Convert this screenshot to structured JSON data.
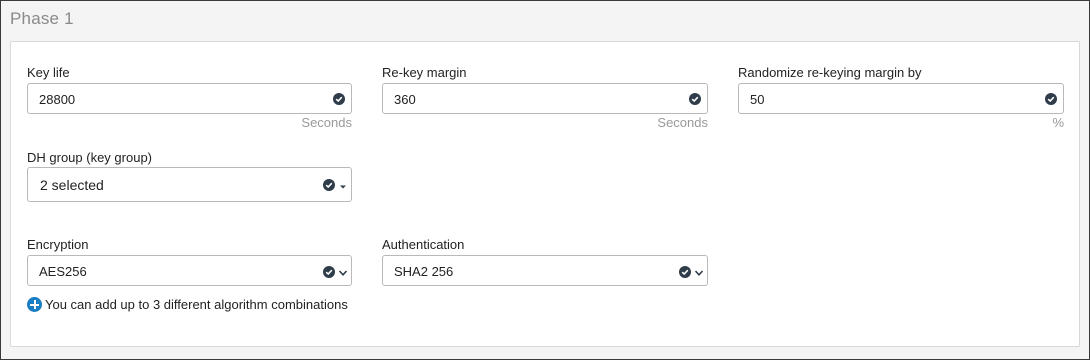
{
  "section": {
    "title": "Phase 1"
  },
  "key_life": {
    "label": "Key life",
    "value": "28800",
    "unit": "Seconds"
  },
  "rekey_margin": {
    "label": "Re-key margin",
    "value": "360",
    "unit": "Seconds"
  },
  "randomize": {
    "label": "Randomize re-keying margin by",
    "value": "50",
    "unit": "%"
  },
  "dh_group": {
    "label": "DH group (key group)",
    "value": "2 selected"
  },
  "encryption": {
    "label": "Encryption",
    "value": "AES256"
  },
  "authentication": {
    "label": "Authentication",
    "value": "SHA2 256"
  },
  "hint": {
    "text": "You can add up to 3 different algorithm combinations"
  },
  "colors": {
    "accent": "#1a7ec4",
    "check": "#2f3d4a",
    "border": "#b9b9b9"
  },
  "icons": {
    "valid": "check-circle-icon",
    "dropdown": "chevron-down-icon",
    "add": "plus-circle-icon"
  }
}
